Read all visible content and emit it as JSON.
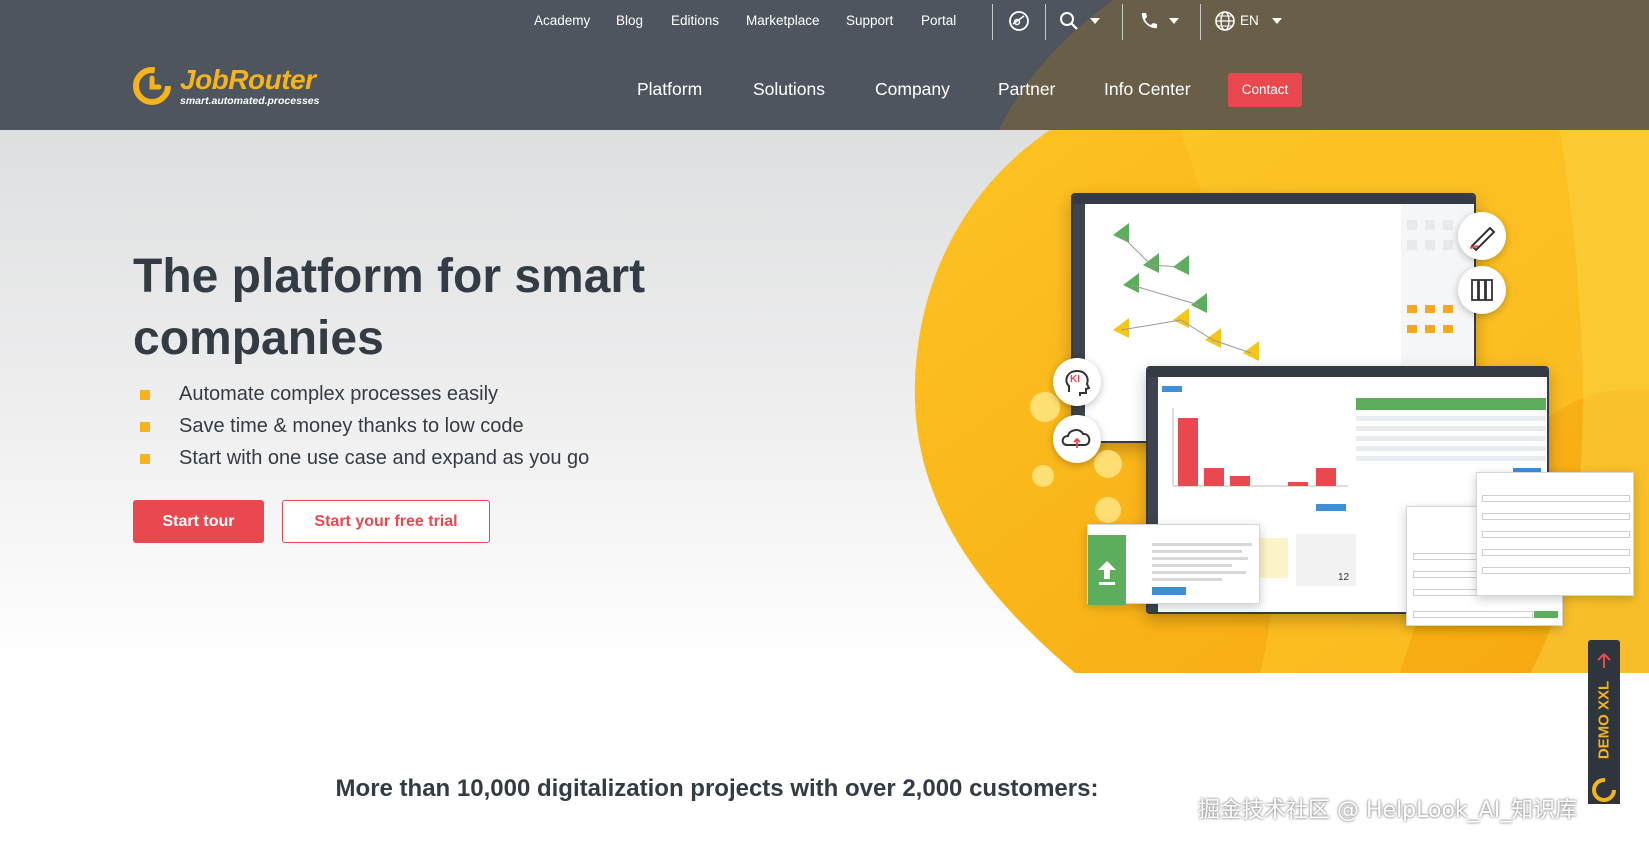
{
  "topnav": {
    "links": [
      "Academy",
      "Blog",
      "Editions",
      "Marketplace",
      "Support",
      "Portal"
    ],
    "language": "EN"
  },
  "brand": {
    "name": "JobRouter",
    "tagline": "smart.automated.processes",
    "color_primary": "#f5b41b",
    "color_accent": "#e8484e",
    "color_header": "#4f555e"
  },
  "mainnav": {
    "items": [
      "Platform",
      "Solutions",
      "Company",
      "Partner",
      "Info Center"
    ],
    "contact": "Contact"
  },
  "hero": {
    "title": "The platform for smart companies",
    "bullets": [
      "Automate complex processes easily",
      "Save time & money thanks to low code",
      "Start with one use case and expand as you go"
    ],
    "cta_primary": "Start tour",
    "cta_secondary": "Start your free trial"
  },
  "illustration": {
    "ki_label": "KI",
    "count": "12"
  },
  "demo_tab": {
    "label": "DEMO XXL"
  },
  "section": {
    "headline": "More than 10,000 digitalization projects with over 2,000 customers:"
  },
  "watermark": "掘金技术社区 @ HelpLook_AI_知识库"
}
